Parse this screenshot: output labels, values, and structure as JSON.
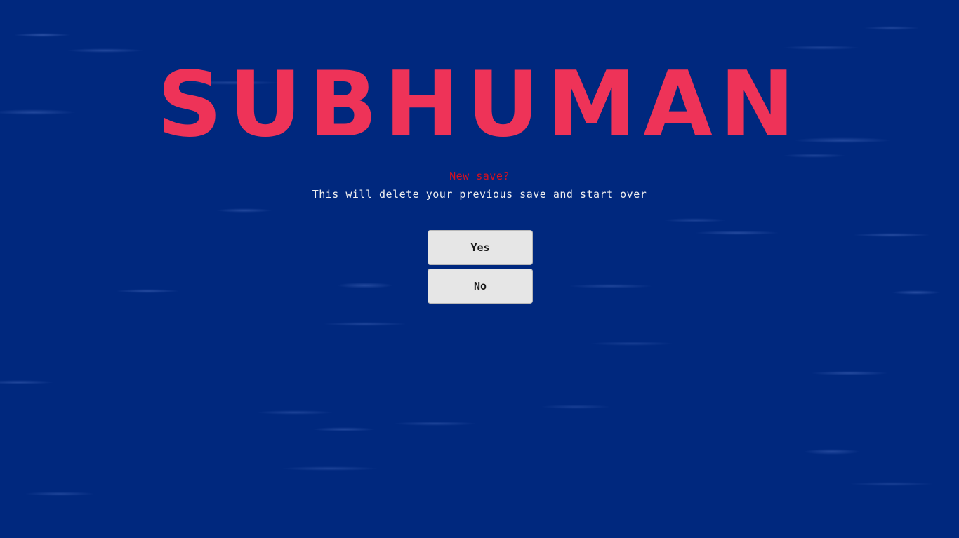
{
  "game": {
    "title": "SUBHUMAN",
    "title_color": "#ee3358",
    "background_color": "#00287e"
  },
  "dialog": {
    "heading": "New save?",
    "heading_color": "#d8101e",
    "message": "This will delete your previous save and start over",
    "buttons": {
      "yes_label": "Yes",
      "no_label": "No"
    }
  }
}
